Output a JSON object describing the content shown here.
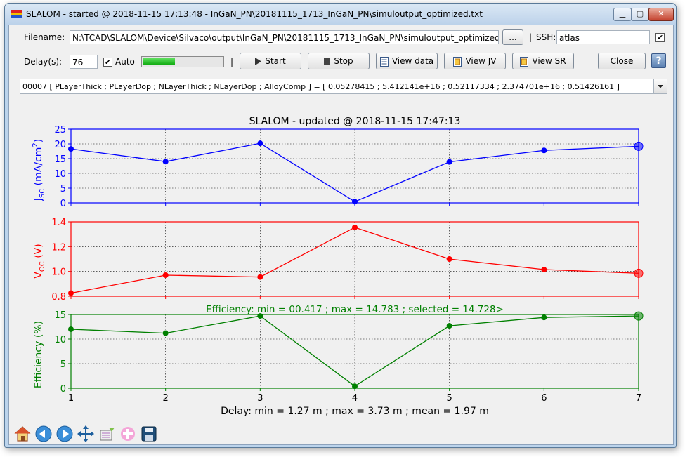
{
  "window": {
    "title": "SLALOM - started @ 2018-11-15 17:13:48 - InGaN_PN\\20181115_1713_InGaN_PN\\simuloutput_optimized.txt"
  },
  "controls": {
    "filename_label": "Filename:",
    "filename_value": "N:\\TCAD\\SLALOM\\Device\\Silvaco\\output\\InGaN_PN\\20181115_1713_InGaN_PN\\simuloutput_optimized.txt",
    "browse_label": "...",
    "sep1": "|",
    "ssh_label": "SSH:",
    "ssh_value": "atlas",
    "ssh_checked": "✔",
    "delay_label": "Delay(s):",
    "delay_value": "76",
    "auto_checked": "✔",
    "auto_label": "Auto",
    "progress": 0.4,
    "sep2": "|",
    "start_label": "Start",
    "stop_label": "Stop",
    "view_data_label": "View data",
    "view_jv_label": "View JV",
    "view_sr_label": "View SR",
    "close_label": "Close",
    "help_label": "?",
    "combo_value": "00007   [ PLayerThick  ;  PLayerDop  ;  NLayerThick  ;  NLayerDop  ;  AlloyComp ]   =   [ 0.05278415  ;  5.412141e+16  ;  0.52117334  ;  2.374701e+16  ;  0.51426161 ]"
  },
  "colors": {
    "jsc": "#0000ff",
    "voc": "#ff0000",
    "eff": "#008000"
  },
  "chart_data": {
    "type": "line",
    "title": "SLALOM - updated @ 2018-11-15 17:47:13",
    "x": [
      1,
      2,
      3,
      4,
      5,
      6,
      7
    ],
    "xlim": [
      1,
      7
    ],
    "xticks": [
      "1",
      "2",
      "3",
      "4",
      "5",
      "6",
      "7"
    ],
    "xlabel": "Delay: min = 1.27 m ; max = 3.73 m ; mean = 1.97 m",
    "grid": true,
    "panels": [
      {
        "ylabel_main": "J",
        "ylabel_sub": "SC",
        "ylabel_rest": " (mA/cm",
        "ylabel_sup": "2",
        "ylabel_end": ")",
        "ylim": [
          0,
          25
        ],
        "yticks": [
          "0",
          "5",
          "10",
          "15",
          "20",
          "25"
        ],
        "values": [
          18.3,
          14.0,
          20.2,
          0.4,
          13.9,
          17.8,
          19.2
        ],
        "selected_index": 6
      },
      {
        "ylabel_main": "V",
        "ylabel_sub": "OC",
        "ylabel_rest": " (V)",
        "ylim": [
          0.8,
          1.4
        ],
        "yticks": [
          "0.8",
          "1.0",
          "1.2",
          "1.4"
        ],
        "values": [
          0.825,
          0.97,
          0.955,
          1.355,
          1.1,
          1.015,
          0.985
        ],
        "selected_index": 6
      },
      {
        "ylabel_main": "Efficiency (%)",
        "title": "Efficiency: min = 00.417 ; max = 14.783 ; selected = 14.728>",
        "ylim": [
          0,
          15
        ],
        "yticks": [
          "0",
          "5",
          "10",
          "15"
        ],
        "values": [
          12.0,
          11.2,
          14.7,
          0.4,
          12.7,
          14.4,
          14.7
        ],
        "selected_index": 6
      }
    ]
  },
  "toolbar": [
    "home-icon",
    "back-icon",
    "forward-icon",
    "pan-icon",
    "zoom-icon",
    "subplots-icon",
    "save-icon"
  ]
}
